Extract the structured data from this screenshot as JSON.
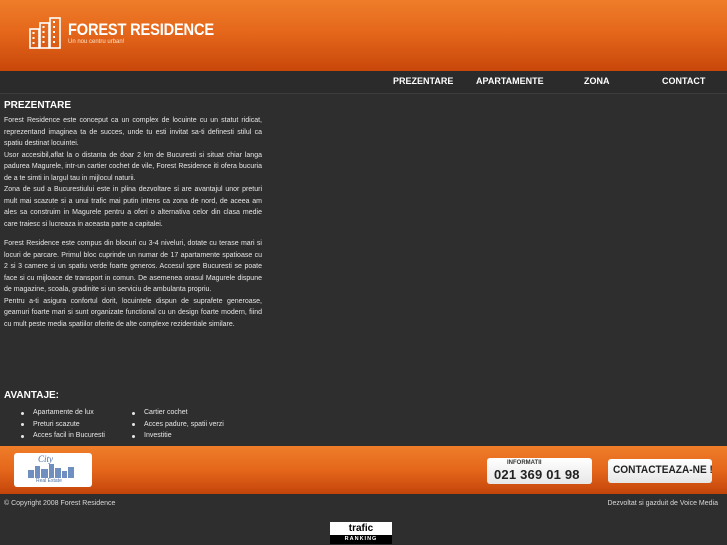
{
  "header": {
    "logo_title": "FOREST RESIDENCE",
    "logo_subtitle": "Un nou centru urban!"
  },
  "nav": {
    "items": [
      {
        "label": "PREZENTARE"
      },
      {
        "label": "APARTAMENTE"
      },
      {
        "label": "ZONA"
      },
      {
        "label": "CONTACT"
      }
    ]
  },
  "main": {
    "title": "PREZENTARE",
    "paragraph1": "Forest Residence este conceput ca un complex de locuinte cu un statut ridicat, reprezentand imaginea ta de succes, unde tu esti invitat sa-ti definesti stilul ca spatiu destinat locuintei.\nUsor accesibil,aflat la o distanta de doar 2 km de Bucuresti si situat chiar langa padurea Magurele, intr-un cartier cochet de vile, Forest Residence iti ofera bucuria de a te simti in largul tau in mijlocul naturii.\nZona de sud a Bucurestiului este in plina dezvoltare si are avantajul unor preturi mult mai scazute si a unui trafic mai putin intens ca zona de nord, de aceea am ales sa construim in Magurele pentru a oferi o alternativa celor din clasa medie care traiesc si lucreaza in aceasta parte a capitalei.",
    "paragraph2": "Forest Residence este compus din blocuri cu 3-4 niveluri, dotate cu terase mari si locuri de parcare. Primul bloc cuprinde un numar de 17 apartamente spatioase cu 2 si 3 camere si un spatiu verde foarte generos. Accesul spre Bucuresti se poate face si cu mijloace de transport in comun. De asemenea orasul Magurele dispune de magazine, scoala, gradinite si un serviciu de ambulanta propriu.\nPentru a-ti asigura confortul dorit, locuintele dispun de suprafete generoase, geamuri foarte mari si sunt organizate functional cu un design foarte modern, fiind cu mult peste media spatiilor oferite de alte complexe rezidentiale similare.",
    "advantages_title": "AVANTAJE:",
    "advantages_col1": [
      "Apartamente de lux",
      "Preturi scazute",
      "Acces facil in Bucuresti"
    ],
    "advantages_col2": [
      "Cartier cochet",
      "Acces padure, spatii verzi",
      "Investitie"
    ]
  },
  "banner": {
    "city_logo_text": "City",
    "city_logo_sub": "Real Estate",
    "phone_label": "INFORMATII",
    "phone_number": "021 369 01 98",
    "contact_label": "CONTACTEAZA-NE !"
  },
  "footer": {
    "copyright": "© Copyright 2008 Forest Residence",
    "credit": "Dezvoltat si gazduit de Voice Media",
    "trafic_top": "trafic",
    "trafic_bottom": "RANKING"
  },
  "colors": {
    "orange": "#e5671b",
    "dark_bg": "#2e2e2e"
  }
}
